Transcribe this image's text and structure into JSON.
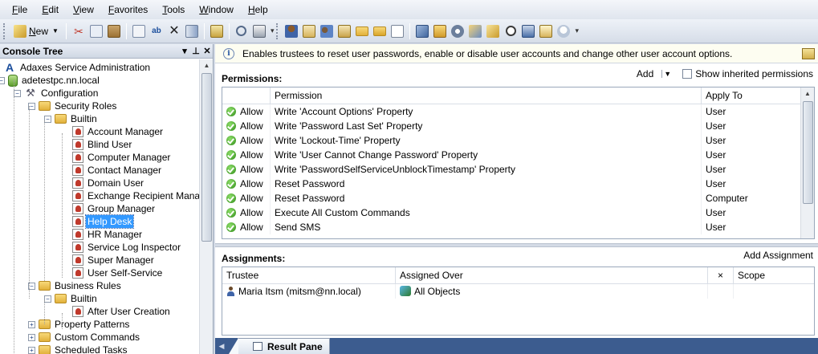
{
  "menu": [
    "File",
    "Edit",
    "View",
    "Favorites",
    "Tools",
    "Window",
    "Help"
  ],
  "toolbar": {
    "new_label": "New"
  },
  "console_tree": {
    "title": "Console Tree",
    "nodes": [
      {
        "label": "Adaxes Service Administration",
        "icon": "adaxes-icon"
      },
      {
        "label": "adetestpc.nn.local",
        "icon": "database-icon"
      },
      {
        "label": "Configuration",
        "icon": "tools-icon"
      },
      {
        "label": "Security Roles",
        "icon": "folder-icon"
      },
      {
        "label": "Builtin",
        "icon": "folder-icon"
      },
      {
        "label": "Account Manager",
        "icon": "security-role-icon"
      },
      {
        "label": "Blind User",
        "icon": "security-role-icon"
      },
      {
        "label": "Computer Manager",
        "icon": "security-role-icon"
      },
      {
        "label": "Contact Manager",
        "icon": "security-role-icon"
      },
      {
        "label": "Domain User",
        "icon": "security-role-icon"
      },
      {
        "label": "Exchange Recipient Manag",
        "icon": "security-role-icon"
      },
      {
        "label": "Group Manager",
        "icon": "security-role-icon"
      },
      {
        "label": "Help Desk",
        "icon": "security-role-icon",
        "selected": true
      },
      {
        "label": "HR Manager",
        "icon": "security-role-icon"
      },
      {
        "label": "Service Log Inspector",
        "icon": "security-role-icon"
      },
      {
        "label": "Super Manager",
        "icon": "security-role-icon"
      },
      {
        "label": "User Self-Service",
        "icon": "security-role-icon"
      },
      {
        "label": "Business Rules",
        "icon": "folder-icon"
      },
      {
        "label": "Builtin",
        "icon": "folder-icon"
      },
      {
        "label": "After User Creation",
        "icon": "business-rule-icon"
      },
      {
        "label": "Property Patterns",
        "icon": "folder-icon"
      },
      {
        "label": "Custom Commands",
        "icon": "folder-icon"
      },
      {
        "label": "Scheduled Tasks",
        "icon": "folder-icon"
      }
    ]
  },
  "description": "Enables trustees to reset user passwords, enable or disable user accounts and change other user account options.",
  "permissions": {
    "title": "Permissions:",
    "add_label": "Add",
    "show_inherited_label": "Show inherited permissions",
    "columns": [
      "Permission",
      "Apply To"
    ],
    "rows": [
      {
        "type": "Allow",
        "permission": "Write 'Account Options' Property",
        "apply_to": "User"
      },
      {
        "type": "Allow",
        "permission": "Write 'Password Last Set' Property",
        "apply_to": "User"
      },
      {
        "type": "Allow",
        "permission": "Write 'Lockout-Time' Property",
        "apply_to": "User"
      },
      {
        "type": "Allow",
        "permission": "Write 'User Cannot Change Password' Property",
        "apply_to": "User"
      },
      {
        "type": "Allow",
        "permission": "Write 'PasswordSelfServiceUnblockTimestamp' Property",
        "apply_to": "User"
      },
      {
        "type": "Allow",
        "permission": "Reset Password",
        "apply_to": "User"
      },
      {
        "type": "Allow",
        "permission": "Reset Password",
        "apply_to": "Computer"
      },
      {
        "type": "Allow",
        "permission": "Execute All Custom Commands",
        "apply_to": "User"
      },
      {
        "type": "Allow",
        "permission": "Send SMS",
        "apply_to": "User"
      }
    ]
  },
  "assignments": {
    "title": "Assignments:",
    "add_label": "Add Assignment",
    "columns": [
      "Trustee",
      "Assigned Over",
      "×",
      "Scope"
    ],
    "rows": [
      {
        "trustee": "Maria Itsm (mitsm@nn.local)",
        "assigned_over": "All Objects",
        "scope": ""
      }
    ]
  },
  "tab": {
    "label": "Result Pane"
  }
}
